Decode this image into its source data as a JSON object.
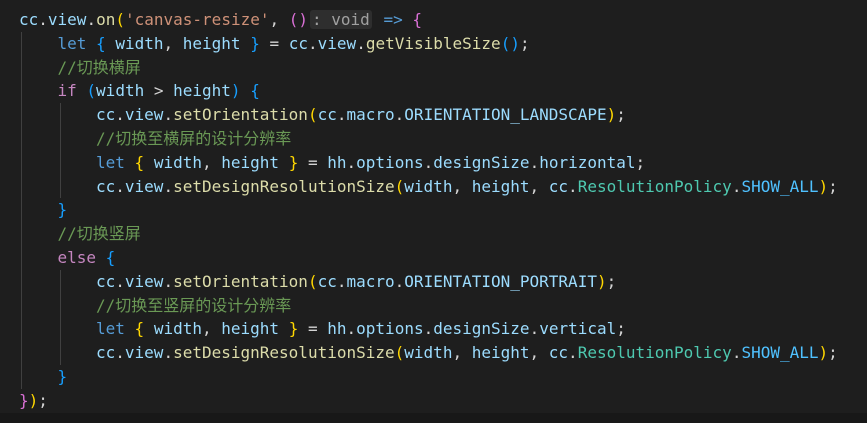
{
  "colors": {
    "var": "#9cdcfe",
    "fn": "#dcdcaa",
    "str": "#ce9178",
    "kw": "#569cd6",
    "ctrl": "#c586c0",
    "cls": "#4ec9b0",
    "const": "#4fc1ff",
    "comment": "#6a9955",
    "punc": "#d4d4d4",
    "brace1": "#ffd700",
    "brace2": "#da70d6",
    "brace3": "#179fff",
    "hint": "#a0a0a0",
    "hintbg": "#2e2e2e"
  },
  "lines": [
    {
      "indent": 0,
      "tokens": [
        {
          "t": "cc",
          "c": "var"
        },
        {
          "t": ".",
          "c": "punc"
        },
        {
          "t": "view",
          "c": "var"
        },
        {
          "t": ".",
          "c": "punc"
        },
        {
          "t": "on",
          "c": "fn"
        },
        {
          "t": "(",
          "c": "brace1"
        },
        {
          "t": "'canvas-resize'",
          "c": "str"
        },
        {
          "t": ", ",
          "c": "punc"
        },
        {
          "t": "()",
          "c": "brace2"
        },
        {
          "t": ": void",
          "c": "hint"
        },
        {
          "t": " ",
          "c": "punc"
        },
        {
          "t": "=>",
          "c": "kw"
        },
        {
          "t": " ",
          "c": "punc"
        },
        {
          "t": "{",
          "c": "brace2"
        }
      ]
    },
    {
      "indent": 1,
      "tokens": [
        {
          "t": "let",
          "c": "kw"
        },
        {
          "t": " ",
          "c": "punc"
        },
        {
          "t": "{",
          "c": "brace3"
        },
        {
          "t": " ",
          "c": "punc"
        },
        {
          "t": "width",
          "c": "var"
        },
        {
          "t": ", ",
          "c": "punc"
        },
        {
          "t": "height",
          "c": "var"
        },
        {
          "t": " ",
          "c": "punc"
        },
        {
          "t": "}",
          "c": "brace3"
        },
        {
          "t": " = ",
          "c": "punc"
        },
        {
          "t": "cc",
          "c": "var"
        },
        {
          "t": ".",
          "c": "punc"
        },
        {
          "t": "view",
          "c": "var"
        },
        {
          "t": ".",
          "c": "punc"
        },
        {
          "t": "getVisibleSize",
          "c": "fn"
        },
        {
          "t": "()",
          "c": "brace3"
        },
        {
          "t": ";",
          "c": "punc"
        }
      ]
    },
    {
      "indent": 1,
      "tokens": [
        {
          "t": "//切换横屏",
          "c": "comment"
        }
      ]
    },
    {
      "indent": 1,
      "tokens": [
        {
          "t": "if",
          "c": "ctrl"
        },
        {
          "t": " ",
          "c": "punc"
        },
        {
          "t": "(",
          "c": "brace3"
        },
        {
          "t": "width",
          "c": "var"
        },
        {
          "t": " > ",
          "c": "punc"
        },
        {
          "t": "height",
          "c": "var"
        },
        {
          "t": ")",
          "c": "brace3"
        },
        {
          "t": " ",
          "c": "punc"
        },
        {
          "t": "{",
          "c": "brace3"
        }
      ]
    },
    {
      "indent": 2,
      "tokens": [
        {
          "t": "cc",
          "c": "var"
        },
        {
          "t": ".",
          "c": "punc"
        },
        {
          "t": "view",
          "c": "var"
        },
        {
          "t": ".",
          "c": "punc"
        },
        {
          "t": "setOrientation",
          "c": "fn"
        },
        {
          "t": "(",
          "c": "brace1"
        },
        {
          "t": "cc",
          "c": "var"
        },
        {
          "t": ".",
          "c": "punc"
        },
        {
          "t": "macro",
          "c": "var"
        },
        {
          "t": ".",
          "c": "punc"
        },
        {
          "t": "ORIENTATION_LANDSCAPE",
          "c": "var"
        },
        {
          "t": ")",
          "c": "brace1"
        },
        {
          "t": ";",
          "c": "punc"
        }
      ]
    },
    {
      "indent": 2,
      "tokens": [
        {
          "t": "//切换至横屏的设计分辨率",
          "c": "comment"
        }
      ]
    },
    {
      "indent": 2,
      "tokens": [
        {
          "t": "let",
          "c": "kw"
        },
        {
          "t": " ",
          "c": "punc"
        },
        {
          "t": "{",
          "c": "brace1"
        },
        {
          "t": " ",
          "c": "punc"
        },
        {
          "t": "width",
          "c": "var"
        },
        {
          "t": ", ",
          "c": "punc"
        },
        {
          "t": "height",
          "c": "var"
        },
        {
          "t": " ",
          "c": "punc"
        },
        {
          "t": "}",
          "c": "brace1"
        },
        {
          "t": " = ",
          "c": "punc"
        },
        {
          "t": "hh",
          "c": "var"
        },
        {
          "t": ".",
          "c": "punc"
        },
        {
          "t": "options",
          "c": "var"
        },
        {
          "t": ".",
          "c": "punc"
        },
        {
          "t": "designSize",
          "c": "var"
        },
        {
          "t": ".",
          "c": "punc"
        },
        {
          "t": "horizontal",
          "c": "var"
        },
        {
          "t": ";",
          "c": "punc"
        }
      ]
    },
    {
      "indent": 2,
      "tokens": [
        {
          "t": "cc",
          "c": "var"
        },
        {
          "t": ".",
          "c": "punc"
        },
        {
          "t": "view",
          "c": "var"
        },
        {
          "t": ".",
          "c": "punc"
        },
        {
          "t": "setDesignResolutionSize",
          "c": "fn"
        },
        {
          "t": "(",
          "c": "brace1"
        },
        {
          "t": "width",
          "c": "var"
        },
        {
          "t": ", ",
          "c": "punc"
        },
        {
          "t": "height",
          "c": "var"
        },
        {
          "t": ", ",
          "c": "punc"
        },
        {
          "t": "cc",
          "c": "var"
        },
        {
          "t": ".",
          "c": "punc"
        },
        {
          "t": "ResolutionPolicy",
          "c": "cls"
        },
        {
          "t": ".",
          "c": "punc"
        },
        {
          "t": "SHOW_ALL",
          "c": "const"
        },
        {
          "t": ")",
          "c": "brace1"
        },
        {
          "t": ";",
          "c": "punc"
        }
      ]
    },
    {
      "indent": 1,
      "tokens": [
        {
          "t": "}",
          "c": "brace3"
        }
      ]
    },
    {
      "indent": 1,
      "tokens": [
        {
          "t": "//切换竖屏",
          "c": "comment"
        }
      ]
    },
    {
      "indent": 1,
      "tokens": [
        {
          "t": "else",
          "c": "ctrl"
        },
        {
          "t": " ",
          "c": "punc"
        },
        {
          "t": "{",
          "c": "brace3"
        }
      ]
    },
    {
      "indent": 2,
      "tokens": [
        {
          "t": "cc",
          "c": "var"
        },
        {
          "t": ".",
          "c": "punc"
        },
        {
          "t": "view",
          "c": "var"
        },
        {
          "t": ".",
          "c": "punc"
        },
        {
          "t": "setOrientation",
          "c": "fn"
        },
        {
          "t": "(",
          "c": "brace1"
        },
        {
          "t": "cc",
          "c": "var"
        },
        {
          "t": ".",
          "c": "punc"
        },
        {
          "t": "macro",
          "c": "var"
        },
        {
          "t": ".",
          "c": "punc"
        },
        {
          "t": "ORIENTATION_PORTRAIT",
          "c": "var"
        },
        {
          "t": ")",
          "c": "brace1"
        },
        {
          "t": ";",
          "c": "punc"
        }
      ]
    },
    {
      "indent": 2,
      "tokens": [
        {
          "t": "//切换至竖屏的设计分辨率",
          "c": "comment"
        }
      ]
    },
    {
      "indent": 2,
      "tokens": [
        {
          "t": "let",
          "c": "kw"
        },
        {
          "t": " ",
          "c": "punc"
        },
        {
          "t": "{",
          "c": "brace1"
        },
        {
          "t": " ",
          "c": "punc"
        },
        {
          "t": "width",
          "c": "var"
        },
        {
          "t": ", ",
          "c": "punc"
        },
        {
          "t": "height",
          "c": "var"
        },
        {
          "t": " ",
          "c": "punc"
        },
        {
          "t": "}",
          "c": "brace1"
        },
        {
          "t": " = ",
          "c": "punc"
        },
        {
          "t": "hh",
          "c": "var"
        },
        {
          "t": ".",
          "c": "punc"
        },
        {
          "t": "options",
          "c": "var"
        },
        {
          "t": ".",
          "c": "punc"
        },
        {
          "t": "designSize",
          "c": "var"
        },
        {
          "t": ".",
          "c": "punc"
        },
        {
          "t": "vertical",
          "c": "var"
        },
        {
          "t": ";",
          "c": "punc"
        }
      ]
    },
    {
      "indent": 2,
      "tokens": [
        {
          "t": "cc",
          "c": "var"
        },
        {
          "t": ".",
          "c": "punc"
        },
        {
          "t": "view",
          "c": "var"
        },
        {
          "t": ".",
          "c": "punc"
        },
        {
          "t": "setDesignResolutionSize",
          "c": "fn"
        },
        {
          "t": "(",
          "c": "brace1"
        },
        {
          "t": "width",
          "c": "var"
        },
        {
          "t": ", ",
          "c": "punc"
        },
        {
          "t": "height",
          "c": "var"
        },
        {
          "t": ", ",
          "c": "punc"
        },
        {
          "t": "cc",
          "c": "var"
        },
        {
          "t": ".",
          "c": "punc"
        },
        {
          "t": "ResolutionPolicy",
          "c": "cls"
        },
        {
          "t": ".",
          "c": "punc"
        },
        {
          "t": "SHOW_ALL",
          "c": "const"
        },
        {
          "t": ")",
          "c": "brace1"
        },
        {
          "t": ";",
          "c": "punc"
        }
      ]
    },
    {
      "indent": 1,
      "tokens": [
        {
          "t": "}",
          "c": "brace3"
        }
      ]
    },
    {
      "indent": 0,
      "tokens": [
        {
          "t": "}",
          "c": "brace2"
        },
        {
          "t": ")",
          "c": "brace1"
        },
        {
          "t": ";",
          "c": "punc"
        }
      ]
    }
  ]
}
